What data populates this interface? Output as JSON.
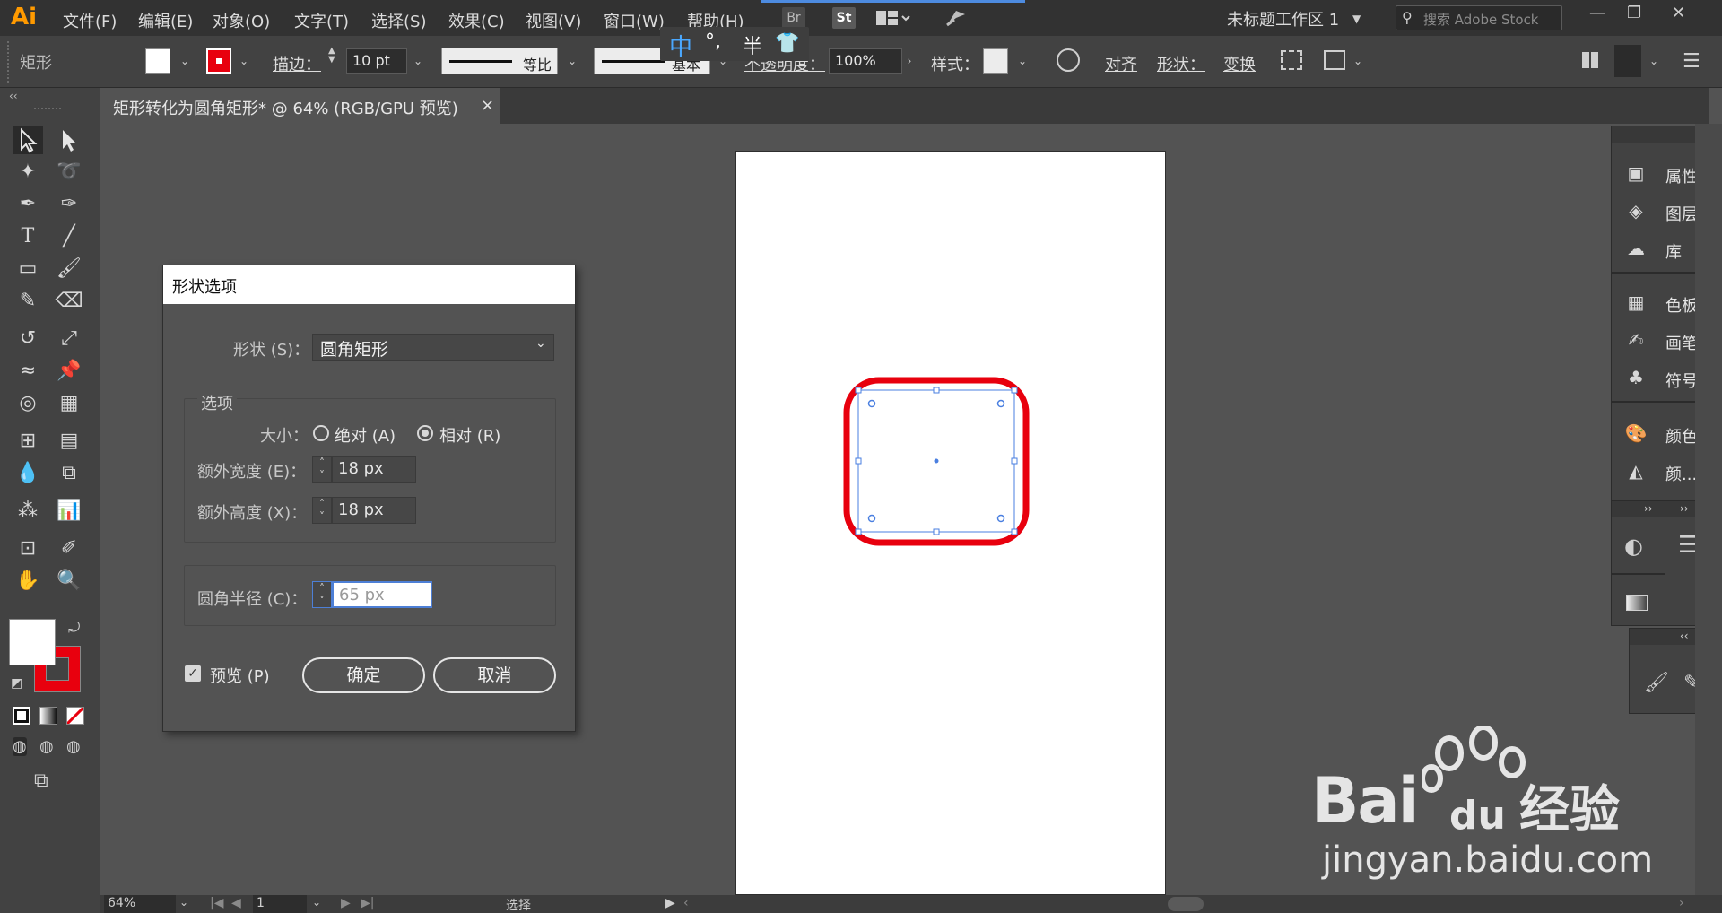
{
  "menubar": {
    "logo": "Ai",
    "items": [
      "文件(F)",
      "编辑(E)",
      "对象(O)",
      "文字(T)",
      "选择(S)",
      "效果(C)",
      "视图(V)",
      "窗口(W)",
      "帮助(H)"
    ],
    "br_label": "Br",
    "st_label": "St",
    "workspace": "未标题工作区 1",
    "search_placeholder": "搜索 Adobe Stock"
  },
  "ime": {
    "lang": "中",
    "punct": "°,",
    "width": "半"
  },
  "control": {
    "tool_name": "矩形",
    "stroke_label": "描边：",
    "stroke_value": "10 pt",
    "profile_label": "等比",
    "brush_label": "基本",
    "opacity_label": "不透明度：",
    "opacity_value": "100%",
    "style_label": "样式：",
    "align_label": "对齐",
    "shape_label": "形状：",
    "transform_label": "变换"
  },
  "document": {
    "tab_title": "矩形转化为圆角矩形* @ 64% (RGB/GPU 预览)",
    "close": "×"
  },
  "dialog": {
    "title": "形状选项",
    "shape_label": "形状 (S)：",
    "shape_value": "圆角矩形",
    "options_label": "选项",
    "size_label": "大小：",
    "absolute_label": "绝对 (A)",
    "relative_label": "相对 (R)",
    "size_mode": "relative",
    "extra_width_label": "额外宽度 (E)：",
    "extra_width_value": "18 px",
    "extra_height_label": "额外高度 (X)：",
    "extra_height_value": "18 px",
    "corner_radius_label": "圆角半径 (C)：",
    "corner_radius_value": "65 px",
    "preview_label": "预览 (P)",
    "preview_checked": true,
    "ok_label": "确定",
    "cancel_label": "取消"
  },
  "right_panels": {
    "group1": [
      "属性",
      "图层",
      "库"
    ],
    "group2": [
      "色板",
      "画笔",
      "符号"
    ],
    "group3": [
      "颜色",
      "颜..."
    ]
  },
  "status": {
    "zoom": "64%",
    "artboard": "1",
    "tool_status": "选择"
  },
  "watermark": {
    "brand": "Bai",
    "brand2": "du",
    "product": "经验",
    "url": "jingyan.baidu.com"
  },
  "colors": {
    "stroke_red": "#e8000e",
    "selection_blue": "#4a7fe0",
    "ui_dark": "#535353"
  }
}
